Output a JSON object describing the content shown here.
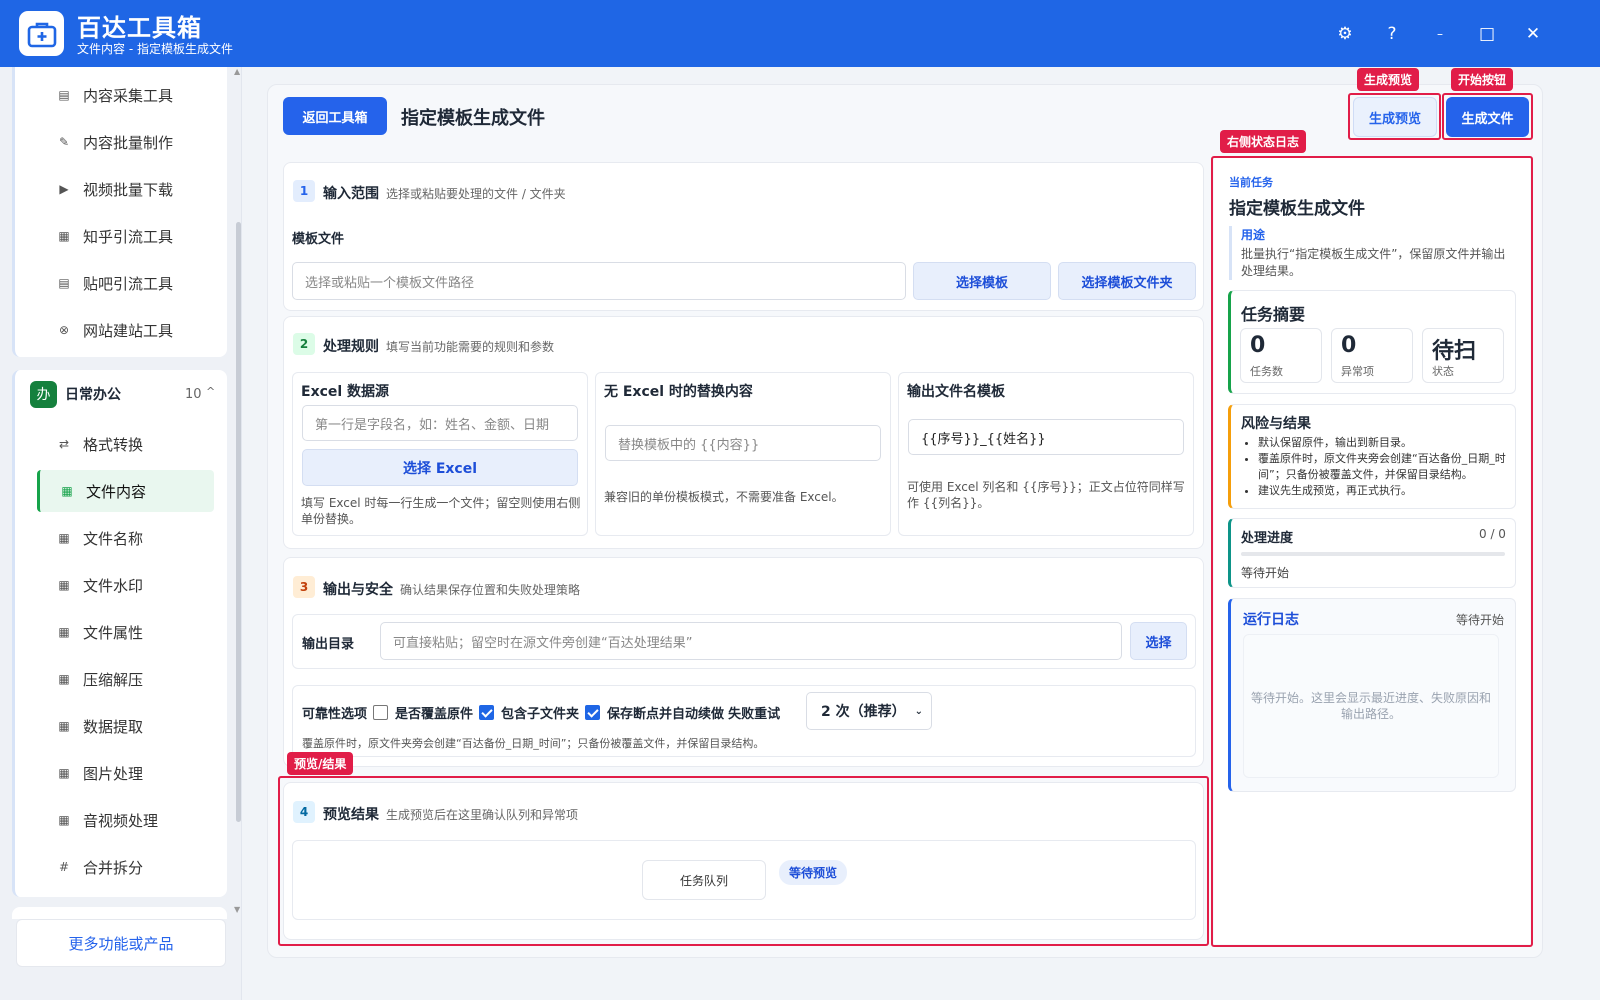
{
  "app": {
    "title": "百达工具箱",
    "subtitle": "文件内容 - 指定模板生成文件"
  },
  "window_controls": {
    "settings_icon": "⚙",
    "help_icon": "?",
    "minimize_icon": "–",
    "maximize_icon": "□",
    "close_icon": "✕"
  },
  "sidebar": {
    "top_items": [
      {
        "label": "内容采集工具",
        "icon": "▤"
      },
      {
        "label": "内容批量制作",
        "icon": "✎"
      },
      {
        "label": "视频批量下载",
        "icon": "▶"
      },
      {
        "label": "知乎引流工具",
        "icon": "▦"
      },
      {
        "label": "贴吧引流工具",
        "icon": "▤"
      },
      {
        "label": "网站建站工具",
        "icon": "⊗"
      }
    ],
    "group": {
      "badge": "办",
      "label": "日常办公",
      "count": "10",
      "caret": "^"
    },
    "group_items": [
      {
        "label": "格式转换",
        "icon": "⇄"
      },
      {
        "label": "文件内容",
        "icon": "▦"
      },
      {
        "label": "文件名称",
        "icon": "▦"
      },
      {
        "label": "文件水印",
        "icon": "▦"
      },
      {
        "label": "文件属性",
        "icon": "▦"
      },
      {
        "label": "压缩解压",
        "icon": "▦"
      },
      {
        "label": "数据提取",
        "icon": "▦"
      },
      {
        "label": "图片处理",
        "icon": "▦"
      },
      {
        "label": "音视频处理",
        "icon": "▦"
      },
      {
        "label": "合并拆分",
        "icon": "#"
      }
    ],
    "active_item": "文件内容",
    "more_label": "更多功能或产品"
  },
  "toolbar": {
    "back_label": "返回工具箱",
    "page_title": "指定模板生成文件",
    "preview_label": "生成预览",
    "generate_label": "生成文件"
  },
  "annotations": {
    "preview_tag": "生成预览",
    "start_tag": "开始按钮",
    "log_tag": "右侧状态日志",
    "result_tag": "预览/结果"
  },
  "step1": {
    "num": "1",
    "title": "输入范围",
    "desc": "选择或粘贴要处理的文件 / 文件夹",
    "field_label": "模板文件",
    "placeholder": "选择或粘贴一个模板文件路径",
    "btn_select": "选择模板",
    "btn_select_folder": "选择模板文件夹"
  },
  "step2": {
    "num": "2",
    "title": "处理规则",
    "desc": "填写当前功能需要的规则和参数",
    "excel": {
      "title": "Excel 数据源",
      "placeholder": "第一行是字段名，如：姓名、金额、日期",
      "btn": "选择 Excel",
      "note": "填写 Excel 时每一行生成一个文件；留空则使用右侧单份替换。"
    },
    "replace": {
      "title": "无 Excel 时的替换内容",
      "placeholder": "替换模板中的 {{内容}}",
      "note": "兼容旧的单份模板模式，不需要准备 Excel。"
    },
    "output_name": {
      "title": "输出文件名模板",
      "value": "{{序号}}_{{姓名}}",
      "note": "可使用 Excel 列名和 {{序号}}；正文占位符同样写作 {{列名}}。"
    }
  },
  "step3": {
    "num": "3",
    "title": "输出与安全",
    "desc": "确认结果保存位置和失败处理策略",
    "dir_label": "输出目录",
    "dir_placeholder": "可直接粘贴；留空时在源文件旁创建“百达处理结果”",
    "dir_btn": "选择",
    "options_label": "可靠性选项",
    "opt_overwrite": "是否覆盖原件",
    "opt_overwrite_checked": false,
    "opt_subfolder": "包含子文件夹",
    "opt_subfolder_checked": true,
    "opt_resume": "保存断点并自动续做",
    "opt_resume_checked": true,
    "retry_label": "失败重试",
    "retry_value": "2 次（推荐）",
    "note": "覆盖原件时，原文件夹旁会创建“百达备份_日期_时间”；只备份被覆盖文件，并保留目录结构。"
  },
  "step4": {
    "num": "4",
    "title": "预览结果",
    "desc": "生成预览后在这里确认队列和异常项",
    "queue_label": "任务队列",
    "queue_status": "等待预览"
  },
  "right_panel": {
    "current_label": "当前任务",
    "current_title": "指定模板生成文件",
    "purpose_label": "用途",
    "purpose_text": "批量执行“指定模板生成文件”，保留原文件并输出处理结果。",
    "summary_title": "任务摘要",
    "stats": [
      {
        "value": "0",
        "label": "任务数"
      },
      {
        "value": "0",
        "label": "异常项"
      },
      {
        "value": "待扫",
        "label": "状态"
      }
    ],
    "risk_title": "风险与结果",
    "risk_items": [
      "默认保留原件，输出到新目录。",
      "覆盖原件时，原文件夹旁会创建“百达备份_日期_时间”；只备份被覆盖文件，并保留目录结构。",
      "建议先生成预览，再正式执行。"
    ],
    "progress_title": "处理进度",
    "progress_value": "0 / 0",
    "progress_fraction": 0,
    "progress_status": "等待开始",
    "log_title": "运行日志",
    "log_status": "等待开始",
    "log_placeholder": "等待开始。这里会显示最近进度、失败原因和输出路径。"
  },
  "colors": {
    "primary": "#1f66e5",
    "active_green": "#16a34a",
    "annotation_red": "#e11d48"
  }
}
